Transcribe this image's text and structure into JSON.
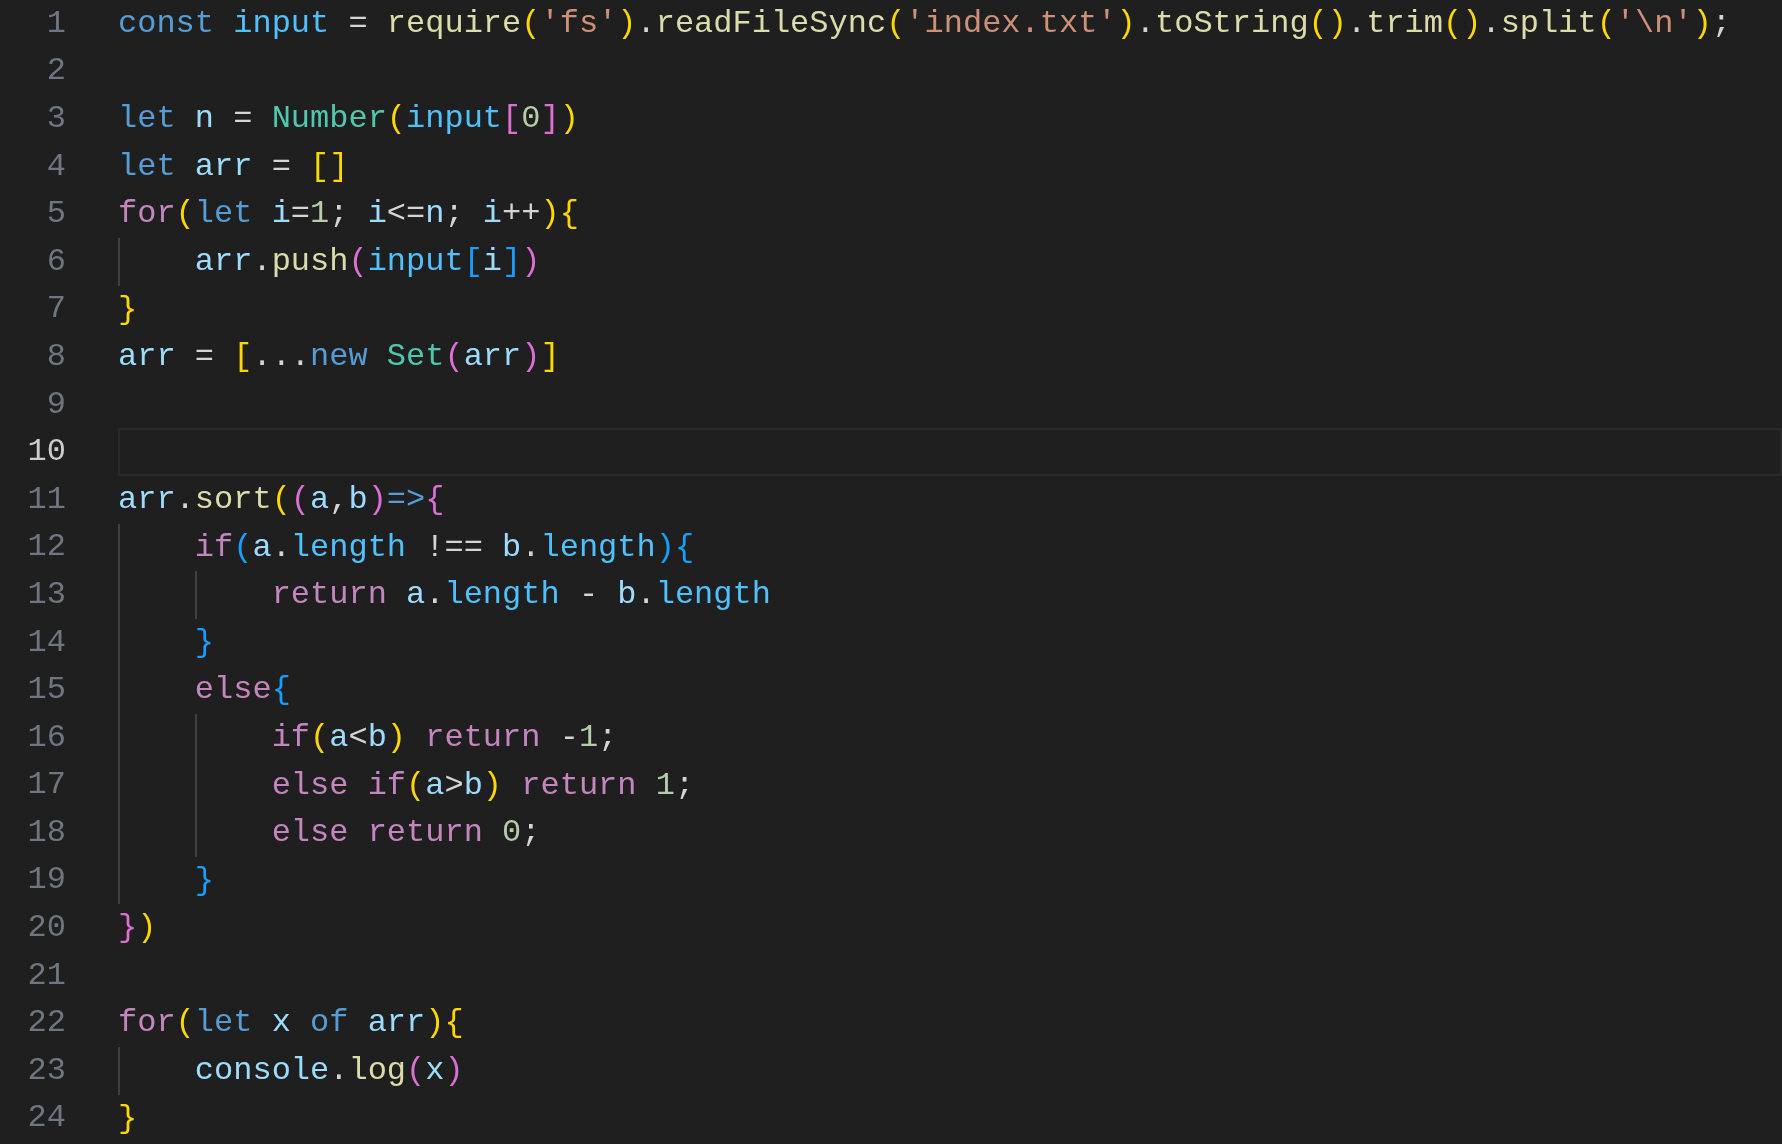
{
  "editor": {
    "lines": [
      {
        "number": "1",
        "selected": false,
        "tokens": [
          {
            "kind": "keyword",
            "text": "const "
          },
          {
            "kind": "constant",
            "text": "input"
          },
          {
            "kind": "operator",
            "text": " = "
          },
          {
            "kind": "function",
            "text": "require"
          },
          {
            "kind": "bracket1",
            "text": "("
          },
          {
            "kind": "string",
            "text": "'fs'"
          },
          {
            "kind": "bracket1",
            "text": ")"
          },
          {
            "kind": "operator",
            "text": "."
          },
          {
            "kind": "function",
            "text": "readFileSync"
          },
          {
            "kind": "bracket1",
            "text": "("
          },
          {
            "kind": "string",
            "text": "'index.txt'"
          },
          {
            "kind": "bracket1",
            "text": ")"
          },
          {
            "kind": "operator",
            "text": "."
          },
          {
            "kind": "function",
            "text": "toString"
          },
          {
            "kind": "bracket1",
            "text": "()"
          },
          {
            "kind": "operator",
            "text": "."
          },
          {
            "kind": "function",
            "text": "trim"
          },
          {
            "kind": "bracket1",
            "text": "()"
          },
          {
            "kind": "operator",
            "text": "."
          },
          {
            "kind": "function",
            "text": "split"
          },
          {
            "kind": "bracket1",
            "text": "("
          },
          {
            "kind": "string",
            "text": "'\\n'"
          },
          {
            "kind": "bracket1",
            "text": ")"
          },
          {
            "kind": "operator",
            "text": ";"
          }
        ]
      },
      {
        "number": "2",
        "selected": false
      },
      {
        "number": "3",
        "selected": false,
        "tokens": [
          {
            "kind": "keyword",
            "text": "let "
          },
          {
            "kind": "variable",
            "text": "n"
          },
          {
            "kind": "operator",
            "text": " = "
          },
          {
            "kind": "type",
            "text": "Number"
          },
          {
            "kind": "bracket1",
            "text": "("
          },
          {
            "kind": "constant",
            "text": "input"
          },
          {
            "kind": "bracket2",
            "text": "["
          },
          {
            "kind": "number",
            "text": "0"
          },
          {
            "kind": "bracket2",
            "text": "]"
          },
          {
            "kind": "bracket1",
            "text": ")"
          }
        ]
      },
      {
        "number": "4",
        "selected": false,
        "tokens": [
          {
            "kind": "keyword",
            "text": "let "
          },
          {
            "kind": "variable",
            "text": "arr"
          },
          {
            "kind": "operator",
            "text": " = "
          },
          {
            "kind": "bracket1",
            "text": "[]"
          }
        ]
      },
      {
        "number": "5",
        "selected": false,
        "tokens": [
          {
            "kind": "control",
            "text": "for"
          },
          {
            "kind": "bracket1",
            "text": "("
          },
          {
            "kind": "keyword",
            "text": "let "
          },
          {
            "kind": "variable",
            "text": "i"
          },
          {
            "kind": "operator",
            "text": "="
          },
          {
            "kind": "number",
            "text": "1"
          },
          {
            "kind": "operator",
            "text": "; "
          },
          {
            "kind": "variable",
            "text": "i"
          },
          {
            "kind": "operator",
            "text": "<="
          },
          {
            "kind": "variable",
            "text": "n"
          },
          {
            "kind": "operator",
            "text": "; "
          },
          {
            "kind": "variable",
            "text": "i"
          },
          {
            "kind": "operator",
            "text": "++"
          },
          {
            "kind": "bracket1",
            "text": ")"
          },
          {
            "kind": "bracket1",
            "text": "{"
          }
        ]
      },
      {
        "number": "6",
        "selected": false,
        "guides": [
          {
            "kind": "guide"
          }
        ],
        "tokens": [
          {
            "kind": "variable",
            "text": "arr"
          },
          {
            "kind": "operator",
            "text": "."
          },
          {
            "kind": "function",
            "text": "push"
          },
          {
            "kind": "bracket2",
            "text": "("
          },
          {
            "kind": "constant",
            "text": "input"
          },
          {
            "kind": "bracket3",
            "text": "["
          },
          {
            "kind": "variable",
            "text": "i"
          },
          {
            "kind": "bracket3",
            "text": "]"
          },
          {
            "kind": "bracket2",
            "text": ")"
          }
        ]
      },
      {
        "number": "7",
        "selected": false,
        "tokens": [
          {
            "kind": "bracket1",
            "text": "}"
          }
        ]
      },
      {
        "number": "8",
        "selected": false,
        "tokens": [
          {
            "kind": "variable",
            "text": "arr"
          },
          {
            "kind": "operator",
            "text": " = "
          },
          {
            "kind": "bracket1",
            "text": "["
          },
          {
            "kind": "operator",
            "text": "..."
          },
          {
            "kind": "keyword",
            "text": "new "
          },
          {
            "kind": "type",
            "text": "Set"
          },
          {
            "kind": "bracket2",
            "text": "("
          },
          {
            "kind": "variable",
            "text": "arr"
          },
          {
            "kind": "bracket2",
            "text": ")"
          },
          {
            "kind": "bracket1",
            "text": "]"
          }
        ]
      },
      {
        "number": "9",
        "selected": false
      },
      {
        "number": "10",
        "selected": true
      },
      {
        "number": "11",
        "selected": false,
        "tokens": [
          {
            "kind": "variable",
            "text": "arr"
          },
          {
            "kind": "operator",
            "text": "."
          },
          {
            "kind": "function",
            "text": "sort"
          },
          {
            "kind": "bracket1",
            "text": "("
          },
          {
            "kind": "bracket2",
            "text": "("
          },
          {
            "kind": "variable",
            "text": "a"
          },
          {
            "kind": "operator",
            "text": ","
          },
          {
            "kind": "variable",
            "text": "b"
          },
          {
            "kind": "bracket2",
            "text": ")"
          },
          {
            "kind": "keyword",
            "text": "=>"
          },
          {
            "kind": "bracket2",
            "text": "{"
          }
        ]
      },
      {
        "number": "12",
        "selected": false,
        "guides": [
          {
            "kind": "guide"
          }
        ],
        "tokens": [
          {
            "kind": "control",
            "text": "if"
          },
          {
            "kind": "bracket3",
            "text": "("
          },
          {
            "kind": "variable",
            "text": "a"
          },
          {
            "kind": "operator",
            "text": "."
          },
          {
            "kind": "property",
            "text": "length"
          },
          {
            "kind": "operator",
            "text": " !== "
          },
          {
            "kind": "variable",
            "text": "b"
          },
          {
            "kind": "operator",
            "text": "."
          },
          {
            "kind": "property",
            "text": "length"
          },
          {
            "kind": "bracket3",
            "text": ")"
          },
          {
            "kind": "bracket3",
            "text": "{"
          }
        ]
      },
      {
        "number": "13",
        "selected": false,
        "guides": [
          {
            "kind": "guide"
          },
          {
            "kind": "guide"
          }
        ],
        "tokens": [
          {
            "kind": "control",
            "text": "return "
          },
          {
            "kind": "variable",
            "text": "a"
          },
          {
            "kind": "operator",
            "text": "."
          },
          {
            "kind": "property",
            "text": "length"
          },
          {
            "kind": "operator",
            "text": " - "
          },
          {
            "kind": "variable",
            "text": "b"
          },
          {
            "kind": "operator",
            "text": "."
          },
          {
            "kind": "property",
            "text": "length"
          }
        ]
      },
      {
        "number": "14",
        "selected": false,
        "guides": [
          {
            "kind": "guide"
          }
        ],
        "tokens": [
          {
            "kind": "bracket3",
            "text": "}"
          }
        ]
      },
      {
        "number": "15",
        "selected": false,
        "guides": [
          {
            "kind": "guide"
          }
        ],
        "tokens": [
          {
            "kind": "control",
            "text": "else"
          },
          {
            "kind": "bracket3",
            "text": "{"
          }
        ]
      },
      {
        "number": "16",
        "selected": false,
        "guides": [
          {
            "kind": "guide"
          },
          {
            "kind": "guide"
          }
        ],
        "tokens": [
          {
            "kind": "control",
            "text": "if"
          },
          {
            "kind": "bracket1",
            "text": "("
          },
          {
            "kind": "variable",
            "text": "a"
          },
          {
            "kind": "operator",
            "text": "<"
          },
          {
            "kind": "variable",
            "text": "b"
          },
          {
            "kind": "bracket1",
            "text": ")"
          },
          {
            "kind": "control",
            "text": " return "
          },
          {
            "kind": "operator",
            "text": "-"
          },
          {
            "kind": "number",
            "text": "1"
          },
          {
            "kind": "operator",
            "text": ";"
          }
        ]
      },
      {
        "number": "17",
        "selected": false,
        "guides": [
          {
            "kind": "guide"
          },
          {
            "kind": "guide"
          }
        ],
        "tokens": [
          {
            "kind": "control",
            "text": "else if"
          },
          {
            "kind": "bracket1",
            "text": "("
          },
          {
            "kind": "variable",
            "text": "a"
          },
          {
            "kind": "operator",
            "text": ">"
          },
          {
            "kind": "variable",
            "text": "b"
          },
          {
            "kind": "bracket1",
            "text": ")"
          },
          {
            "kind": "control",
            "text": " return "
          },
          {
            "kind": "number",
            "text": "1"
          },
          {
            "kind": "operator",
            "text": ";"
          }
        ]
      },
      {
        "number": "18",
        "selected": false,
        "guides": [
          {
            "kind": "guide"
          },
          {
            "kind": "guide"
          }
        ],
        "tokens": [
          {
            "kind": "control",
            "text": "else return "
          },
          {
            "kind": "number",
            "text": "0"
          },
          {
            "kind": "operator",
            "text": ";"
          }
        ]
      },
      {
        "number": "19",
        "selected": false,
        "guides": [
          {
            "kind": "guide"
          }
        ],
        "tokens": [
          {
            "kind": "bracket3",
            "text": "}"
          }
        ]
      },
      {
        "number": "20",
        "selected": false,
        "tokens": [
          {
            "kind": "bracket2",
            "text": "}"
          },
          {
            "kind": "bracket1",
            "text": ")"
          }
        ]
      },
      {
        "number": "21",
        "selected": false
      },
      {
        "number": "22",
        "selected": false,
        "tokens": [
          {
            "kind": "control",
            "text": "for"
          },
          {
            "kind": "bracket1",
            "text": "("
          },
          {
            "kind": "keyword",
            "text": "let "
          },
          {
            "kind": "variable",
            "text": "x"
          },
          {
            "kind": "keyword",
            "text": " of "
          },
          {
            "kind": "variable",
            "text": "arr"
          },
          {
            "kind": "bracket1",
            "text": ")"
          },
          {
            "kind": "bracket1",
            "text": "{"
          }
        ]
      },
      {
        "number": "23",
        "selected": false,
        "guides": [
          {
            "kind": "guide"
          }
        ],
        "tokens": [
          {
            "kind": "variable",
            "text": "console"
          },
          {
            "kind": "operator",
            "text": "."
          },
          {
            "kind": "function",
            "text": "log"
          },
          {
            "kind": "bracket2",
            "text": "("
          },
          {
            "kind": "variable",
            "text": "x"
          },
          {
            "kind": "bracket2",
            "text": ")"
          }
        ]
      },
      {
        "number": "24",
        "selected": false,
        "tokens": [
          {
            "kind": "bracket1",
            "text": "}"
          }
        ]
      }
    ]
  }
}
